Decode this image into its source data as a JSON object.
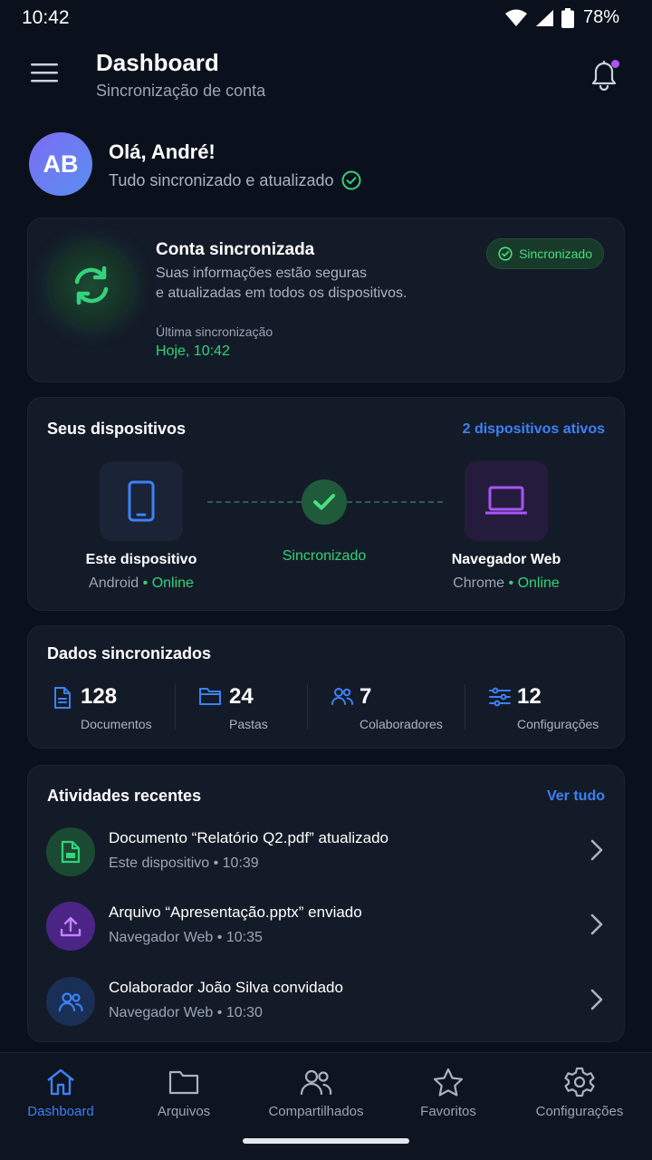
{
  "status_bar": {
    "time": "10:42",
    "battery": "78%"
  },
  "header": {
    "title": "Dashboard",
    "subtitle": "Sincronização de conta"
  },
  "greeting": {
    "avatar_initials": "AB",
    "title": "Olá, André!",
    "subtitle": "Tudo sincronizado e atualizado"
  },
  "sync_card": {
    "title": "Conta sincronizada",
    "description_line1": "Suas informações estão seguras",
    "description_line2": "e atualizadas em todos os dispositivos.",
    "last_sync_label": "Última sincronização",
    "last_sync_value": "Hoje, 10:42",
    "badge": "Sincronizado"
  },
  "devices": {
    "title": "Seus dispositivos",
    "active_link": "2 dispositivos ativos",
    "center_label": "Sincronizado",
    "items": [
      {
        "name": "Este dispositivo",
        "platform": "Android",
        "status": "Online",
        "icon": "phone-icon"
      },
      {
        "name": "Navegador Web",
        "platform": "Chrome",
        "status": "Online",
        "icon": "laptop-icon"
      }
    ]
  },
  "data_stats": {
    "title": "Dados sincronizados",
    "items": [
      {
        "value": "128",
        "label": "Documentos",
        "icon": "document-icon"
      },
      {
        "value": "24",
        "label": "Pastas",
        "icon": "folder-icon"
      },
      {
        "value": "7",
        "label": "Colaboradores",
        "icon": "users-icon"
      },
      {
        "value": "12",
        "label": "Configurações",
        "icon": "sliders-icon"
      }
    ]
  },
  "activities": {
    "title": "Atividades recentes",
    "see_all": "Ver tudo",
    "items": [
      {
        "title": "Documento “Relatório Q2.pdf” atualizado",
        "meta": "Este dispositivo • 10:39",
        "icon": "file-icon"
      },
      {
        "title": "Arquivo “Apresentação.pptx” enviado",
        "meta": "Navegador Web • 10:35",
        "icon": "upload-icon"
      },
      {
        "title": "Colaborador João Silva convidado",
        "meta": "Navegador Web • 10:30",
        "icon": "users-icon"
      }
    ]
  },
  "bottom_nav": {
    "items": [
      {
        "label": "Dashboard",
        "icon": "home-icon",
        "active": true
      },
      {
        "label": "Arquivos",
        "icon": "folder-icon",
        "active": false
      },
      {
        "label": "Compartilhados",
        "icon": "users-icon",
        "active": false
      },
      {
        "label": "Favoritos",
        "icon": "star-icon",
        "active": false
      },
      {
        "label": "Configurações",
        "icon": "gear-icon",
        "active": false
      }
    ]
  },
  "colors": {
    "background": "#0b111c",
    "card": "#141b28",
    "accent_blue": "#3b82f6",
    "accent_green": "#34d27a",
    "accent_purple": "#a855f7"
  }
}
